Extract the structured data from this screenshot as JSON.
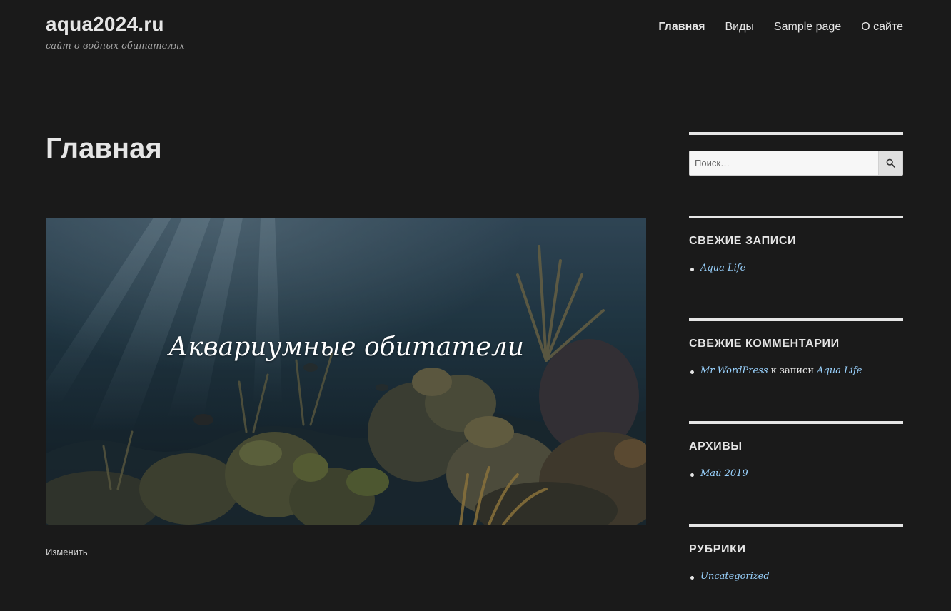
{
  "header": {
    "site_title": "aqua2024.ru",
    "site_description": "сайт о водных обитателях",
    "nav": [
      {
        "label": "Главная",
        "current": true
      },
      {
        "label": "Виды",
        "current": false
      },
      {
        "label": "Sample page",
        "current": false
      },
      {
        "label": "О сайте",
        "current": false
      }
    ]
  },
  "main": {
    "page_title": "Главная",
    "hero_caption": "Аквариумные обитатели",
    "edit_link": "Изменить"
  },
  "sidebar": {
    "search": {
      "placeholder": "Поиск…",
      "button_icon": "search-icon"
    },
    "recent_posts": {
      "title": "СВЕЖИЕ ЗАПИСИ",
      "items": [
        "Aqua Life"
      ]
    },
    "recent_comments": {
      "title": "СВЕЖИЕ КОММЕНТАРИИ",
      "items": [
        {
          "author": "Mr WordPress",
          "connector": " к записи ",
          "post": "Aqua Life"
        }
      ]
    },
    "archives": {
      "title": "АРХИВЫ",
      "items": [
        "Май 2019"
      ]
    },
    "categories": {
      "title": "РУБРИКИ",
      "items": [
        "Uncategorized"
      ]
    }
  },
  "colors": {
    "background": "#1a1a1a",
    "text": "#e5e5e5",
    "link": "#9ad3ff"
  }
}
